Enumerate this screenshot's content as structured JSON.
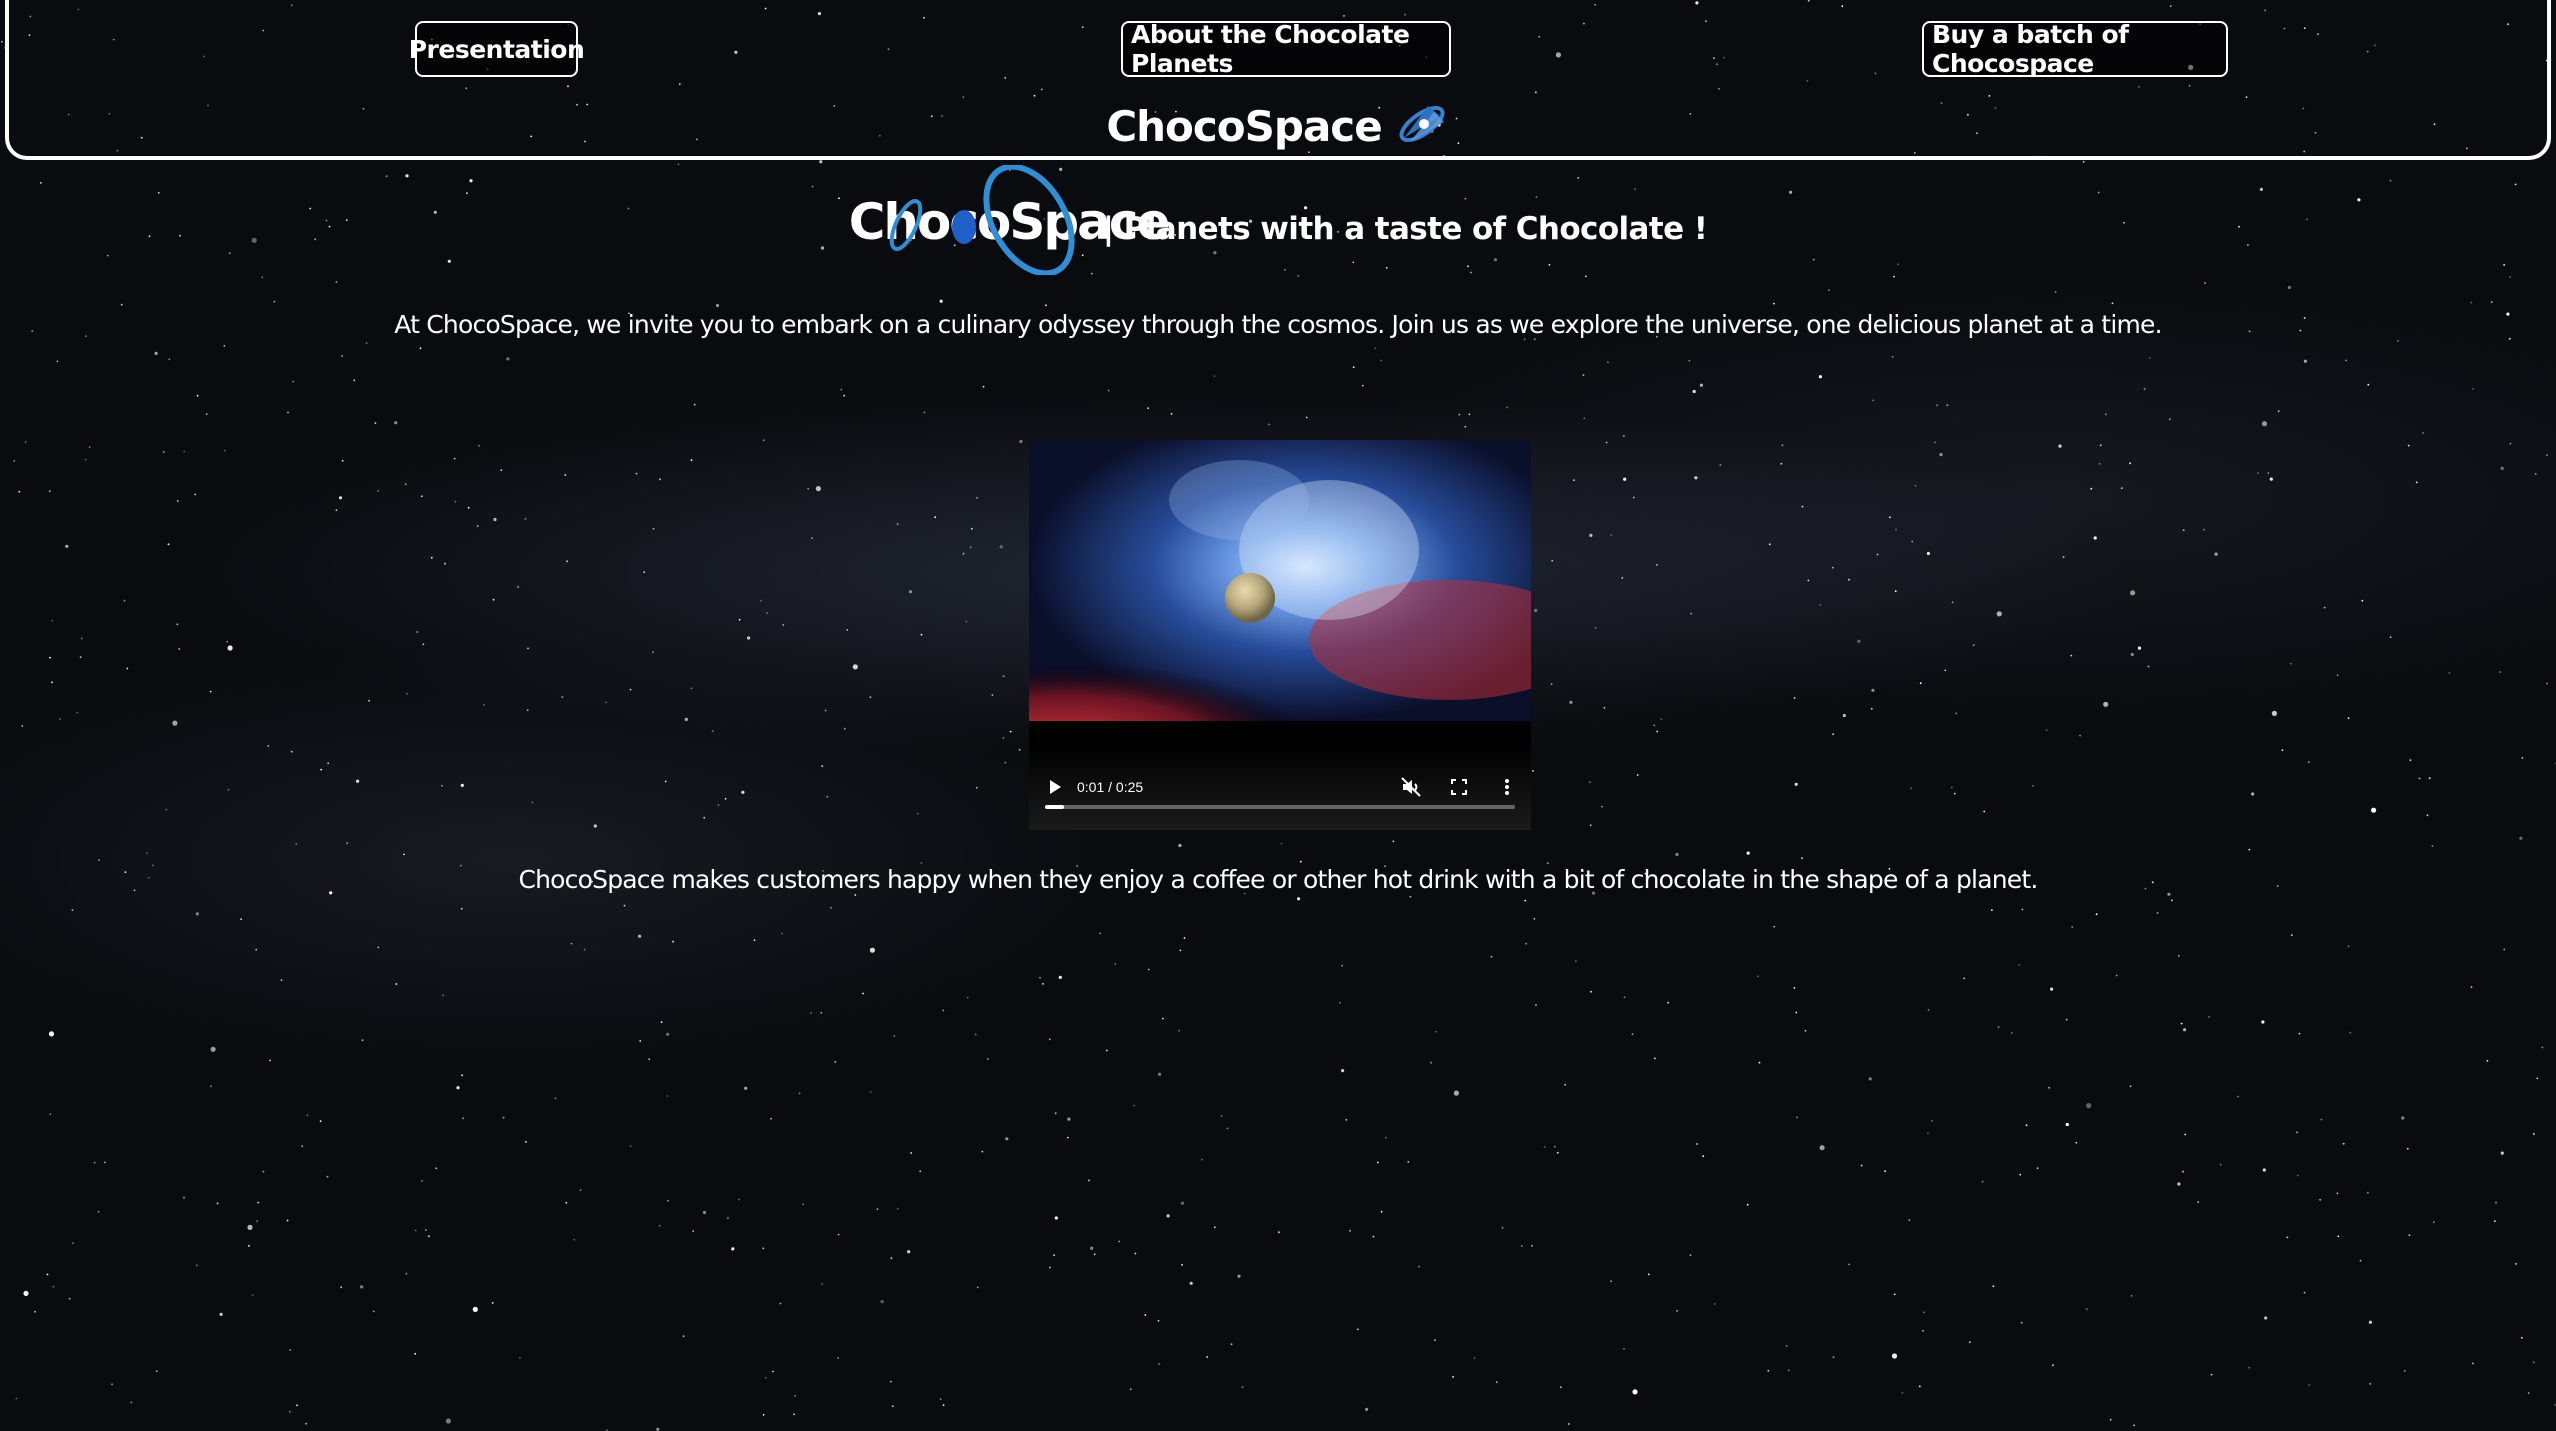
{
  "nav": {
    "presentation": "Presentation",
    "about": "About the Chocolate Planets",
    "buy": "Buy a batch of Chocospace"
  },
  "brand": {
    "name": "ChocoSpace",
    "icon": "planet-rocket-icon"
  },
  "hero": {
    "logo_text": "ChocoSpace",
    "tagline": "| Planets with a taste of Chocolate !",
    "logo_accent": "#2f8fd6"
  },
  "intro": "At ChocoSpace, we invite you to embark on a culinary odyssey through the cosmos. Join us as we explore the universe, one delicious planet at a time.",
  "video": {
    "time": "0:01 / 0:25",
    "progress": 0.04,
    "muted": true
  },
  "outro": "ChocoSpace makes customers happy when they enjoy a coffee or other hot drink with a bit of chocolate in the shape of a planet."
}
